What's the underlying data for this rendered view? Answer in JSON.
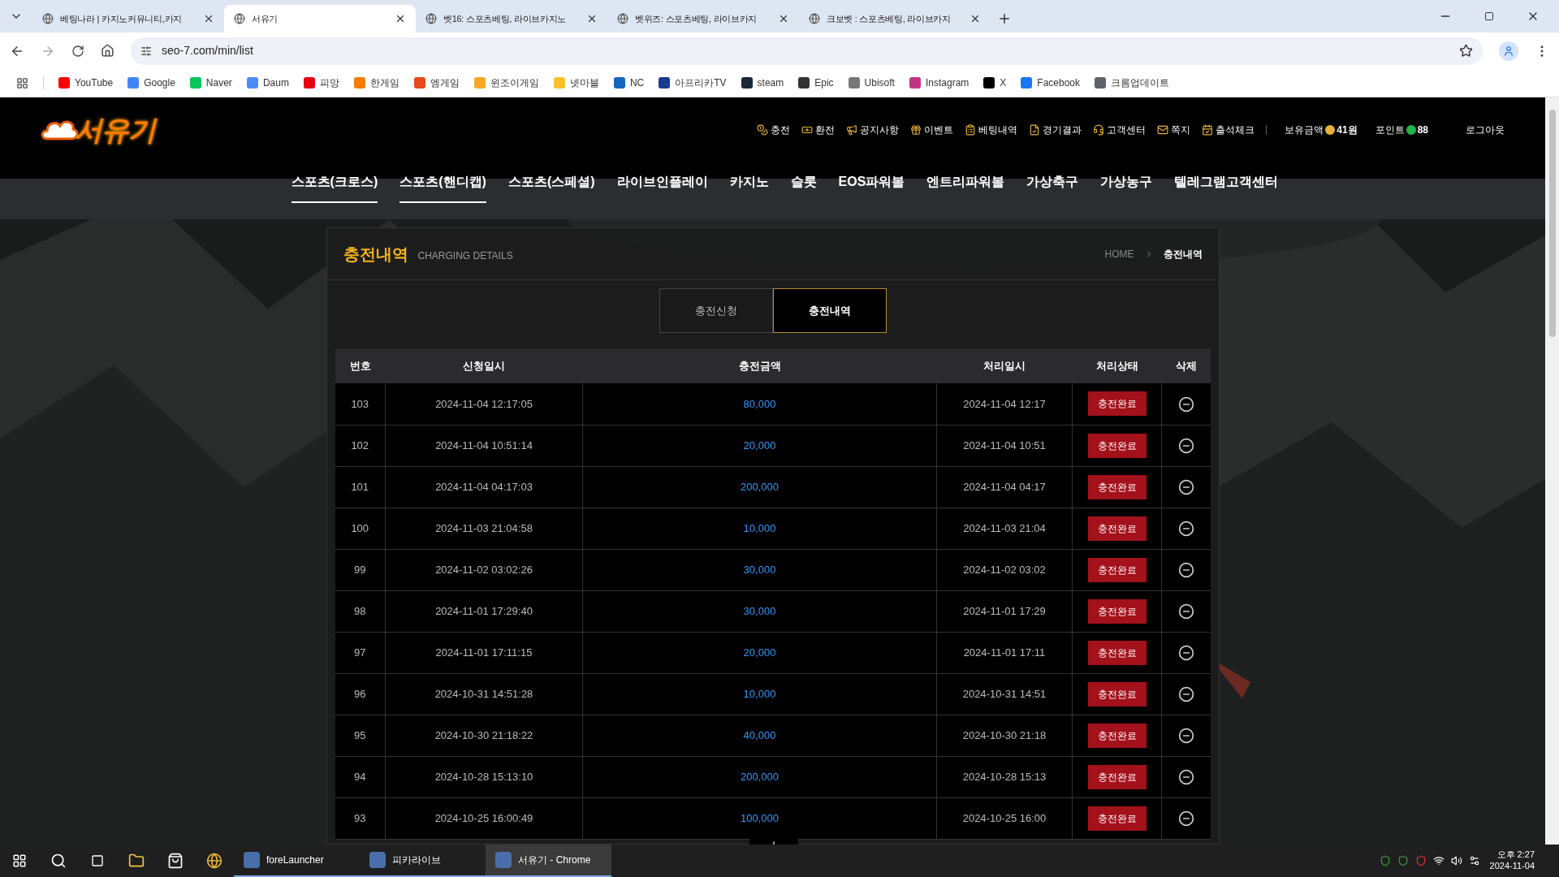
{
  "browser": {
    "tabs": [
      {
        "title": "베팅나라 | 카지노커뮤니티,카지",
        "selected": false
      },
      {
        "title": "서유기",
        "selected": true
      },
      {
        "title": "벳16: 스포츠베팅, 라이브카지노",
        "selected": false
      },
      {
        "title": "벳위즈: 스포츠베팅, 라이브카지",
        "selected": false
      },
      {
        "title": "크보벳 : 스포츠베팅, 라이브카지",
        "selected": false
      }
    ],
    "url": "seo-7.com/min/list",
    "bookmarks": [
      "YouTube",
      "Google",
      "Naver",
      "Daum",
      "피망",
      "한게임",
      "엠게임",
      "윈조이게임",
      "넷마블",
      "NC",
      "아프리카TV",
      "steam",
      "Epic",
      "Ubisoft",
      "Instagram",
      "X",
      "Facebook",
      "크롬업데이트"
    ]
  },
  "site": {
    "logo": "서유기",
    "header_links": [
      "충전",
      "환전",
      "공지사항",
      "이벤트",
      "베팅내역",
      "경기결과",
      "고객센터",
      "쪽지",
      "출석체크"
    ],
    "balance_label": "보유금액",
    "balance": "41원",
    "points_label": "포인트",
    "points": "88",
    "logout": "로그아웃",
    "nav": [
      {
        "label": "스포츠(크로스)",
        "selected": true
      },
      {
        "label": "스포츠(핸디캡)",
        "selected": true
      },
      {
        "label": "스포츠(스페셜)",
        "selected": false
      },
      {
        "label": "라이브인플레이",
        "selected": false
      },
      {
        "label": "카지노",
        "selected": false
      },
      {
        "label": "슬롯",
        "selected": false
      },
      {
        "label": "EOS파워볼",
        "selected": false
      },
      {
        "label": "엔트리파워볼",
        "selected": false
      },
      {
        "label": "가상축구",
        "selected": false
      },
      {
        "label": "가상농구",
        "selected": false
      },
      {
        "label": "텔레그램고객센터",
        "selected": false
      }
    ]
  },
  "page": {
    "title": "충전내역",
    "subtitle": "CHARGING DETAILS",
    "breadcrumb": [
      "HOME",
      "충전내역"
    ],
    "tabs": [
      {
        "label": "충전신청",
        "selected": false
      },
      {
        "label": "충전내역",
        "selected": true
      }
    ]
  },
  "table": {
    "columns": [
      "번호",
      "신청일시",
      "충전금액",
      "처리일시",
      "처리상태",
      "삭제"
    ],
    "rows": [
      {
        "no": "103",
        "requested": "2024-11-04 12:17:05",
        "amount": "80,000",
        "processed": "2024-11-04 12:17",
        "status": "충전완료"
      },
      {
        "no": "102",
        "requested": "2024-11-04 10:51:14",
        "amount": "20,000",
        "processed": "2024-11-04 10:51",
        "status": "충전완료"
      },
      {
        "no": "101",
        "requested": "2024-11-04 04:17:03",
        "amount": "200,000",
        "processed": "2024-11-04 04:17",
        "status": "충전완료"
      },
      {
        "no": "100",
        "requested": "2024-11-03 21:04:58",
        "amount": "10,000",
        "processed": "2024-11-03 21:04",
        "status": "충전완료"
      },
      {
        "no": "99",
        "requested": "2024-11-02 03:02:26",
        "amount": "30,000",
        "processed": "2024-11-02 03:02",
        "status": "충전완료"
      },
      {
        "no": "98",
        "requested": "2024-11-01 17:29:40",
        "amount": "30,000",
        "processed": "2024-11-01 17:29",
        "status": "충전완료"
      },
      {
        "no": "97",
        "requested": "2024-11-01 17:11:15",
        "amount": "20,000",
        "processed": "2024-11-01 17:11",
        "status": "충전완료"
      },
      {
        "no": "96",
        "requested": "2024-10-31 14:51:28",
        "amount": "10,000",
        "processed": "2024-10-31 14:51",
        "status": "충전완료"
      },
      {
        "no": "95",
        "requested": "2024-10-30 21:18:22",
        "amount": "40,000",
        "processed": "2024-10-30 21:18",
        "status": "충전완료"
      },
      {
        "no": "94",
        "requested": "2024-10-28 15:13:10",
        "amount": "200,000",
        "processed": "2024-10-28 15:13",
        "status": "충전완료"
      },
      {
        "no": "93",
        "requested": "2024-10-25 16:00:49",
        "amount": "100,000",
        "processed": "2024-10-25 16:00",
        "status": "충전완료"
      }
    ]
  },
  "taskbar": {
    "apps": [
      {
        "label": "foreLauncher",
        "selected": false
      },
      {
        "label": "피카라이브",
        "selected": false
      },
      {
        "label": "서유기 - Chrome",
        "selected": true
      }
    ],
    "time": "오후 2:27",
    "date": "2024-11-04"
  }
}
